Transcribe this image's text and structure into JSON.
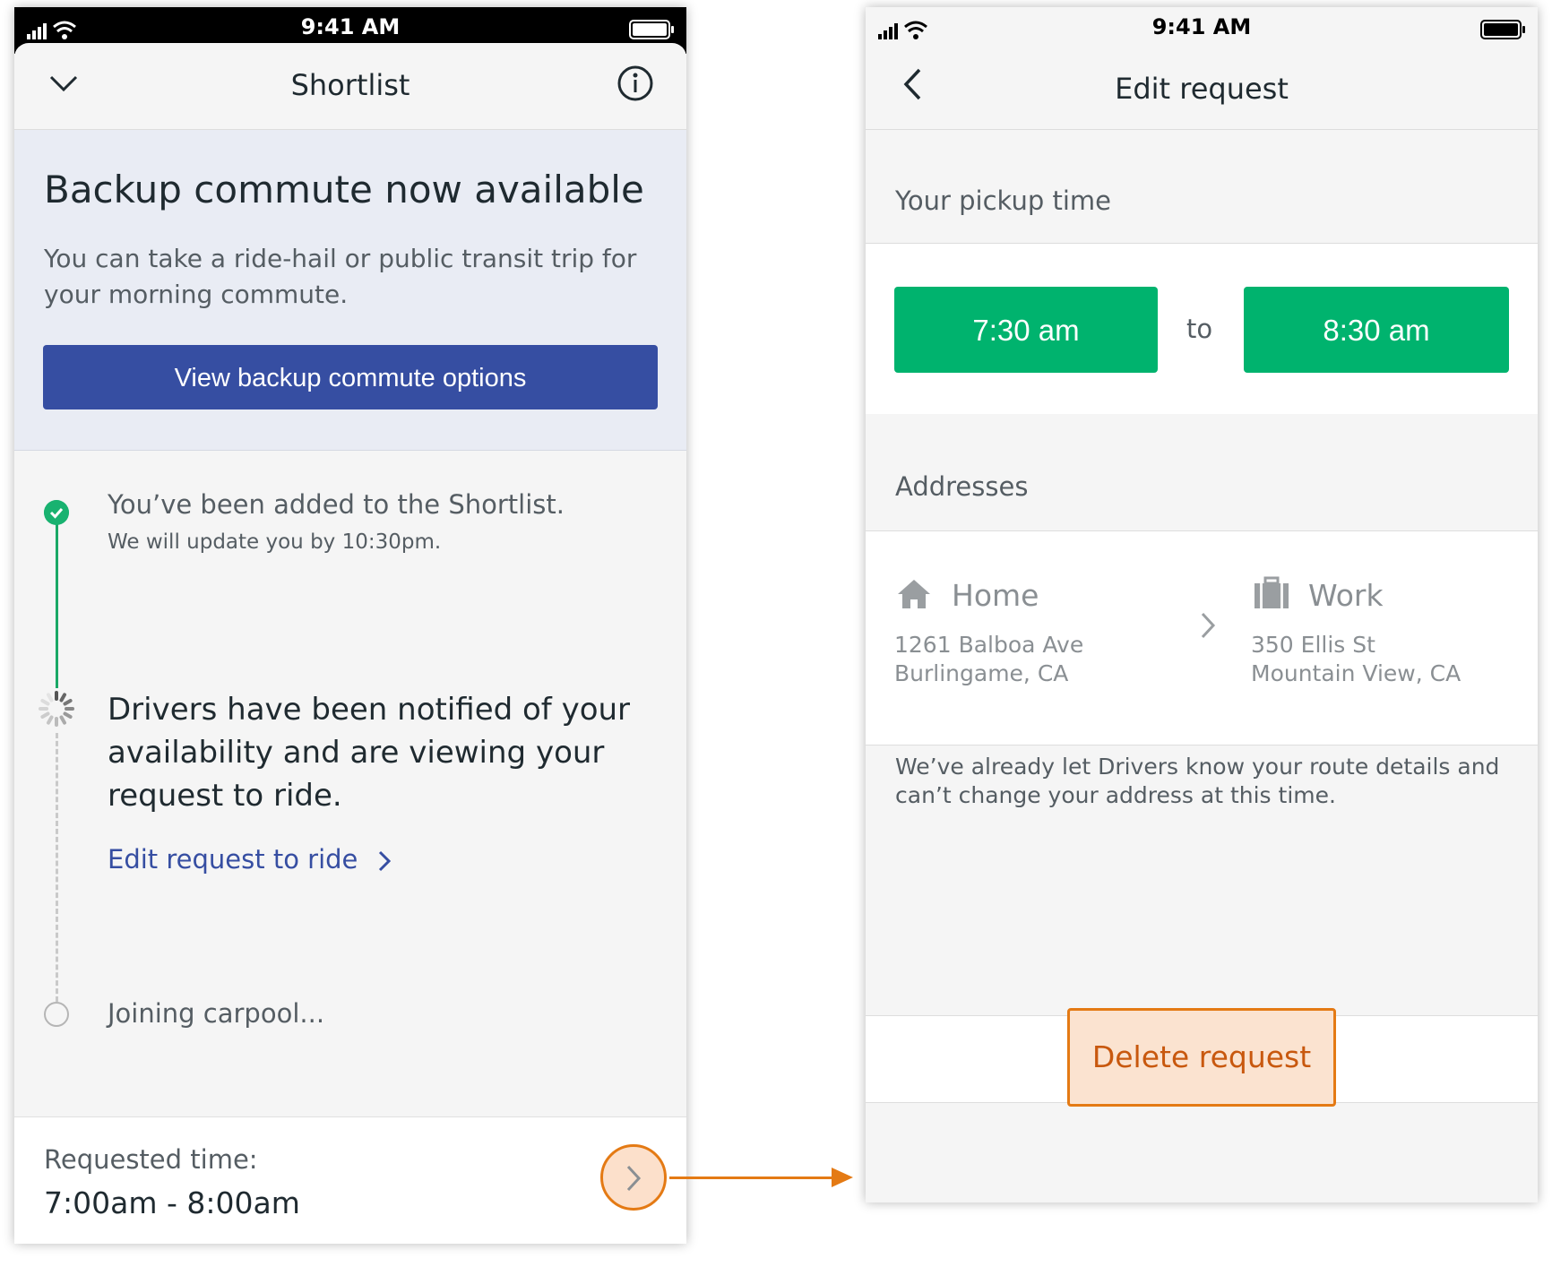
{
  "status_bar": {
    "time": "9:41 AM"
  },
  "left_screen": {
    "title": "Shortlist",
    "icons": {
      "collapse": "chevron-down-icon",
      "info": "info-icon"
    },
    "banner": {
      "title": "Backup commute now available",
      "text": "You can take a ride-hail or public transit trip for your morning commute.",
      "button": "View backup commute options"
    },
    "steps": [
      {
        "status": "done",
        "title": "You’ve been added to the Shortlist.",
        "subtitle": "We will update you by 10:30pm."
      },
      {
        "status": "in-progress",
        "title": "Drivers have been notified of your availability and are viewing your request to ride.",
        "link": "Edit request to ride"
      },
      {
        "status": "pending",
        "title": "Joining carpool..."
      }
    ],
    "footer": {
      "label": "Requested time:",
      "value": "7:00am - 8:00am"
    }
  },
  "right_screen": {
    "title": "Edit request",
    "pickup": {
      "section_label": "Your pickup time",
      "start": "7:30 am",
      "separator": "to",
      "end": "8:30 am"
    },
    "addresses": {
      "section_label": "Addresses",
      "origin": {
        "label": "Home",
        "line1": "1261 Balboa Ave",
        "line2": "Burlingame, CA",
        "icon": "home-icon"
      },
      "destination": {
        "label": "Work",
        "line1": "350 Ellis St",
        "line2": "Mountain View, CA",
        "icon": "briefcase-icon"
      },
      "note": "We’ve already let Drivers know your route details and can’t change your address at this time."
    },
    "delete_button": "Delete request"
  },
  "colors": {
    "primary_blue": "#364ea2",
    "success_green": "#00b36e",
    "highlight_orange": "#e47a14",
    "delete_text": "#c8580e"
  }
}
